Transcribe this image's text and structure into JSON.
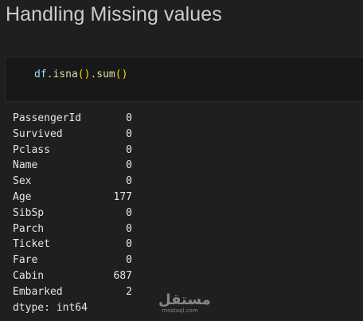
{
  "heading": "Handling Missing values",
  "code": {
    "var": "df",
    "dot1": ".",
    "func1": "isna",
    "paren1_open": "(",
    "paren1_close": ")",
    "dot2": ".",
    "func2": "sum",
    "paren2_open": "(",
    "paren2_close": ")"
  },
  "output": {
    "rows": [
      {
        "name": "PassengerId",
        "count": "0"
      },
      {
        "name": "Survived",
        "count": "0"
      },
      {
        "name": "Pclass",
        "count": "0"
      },
      {
        "name": "Name",
        "count": "0"
      },
      {
        "name": "Sex",
        "count": "0"
      },
      {
        "name": "Age",
        "count": "177"
      },
      {
        "name": "SibSp",
        "count": "0"
      },
      {
        "name": "Parch",
        "count": "0"
      },
      {
        "name": "Ticket",
        "count": "0"
      },
      {
        "name": "Fare",
        "count": "0"
      },
      {
        "name": "Cabin",
        "count": "687"
      },
      {
        "name": "Embarked",
        "count": "2"
      }
    ],
    "dtype": "dtype: int64"
  },
  "watermark": {
    "arabic": "مستقل",
    "latin": "mostaql.com"
  }
}
